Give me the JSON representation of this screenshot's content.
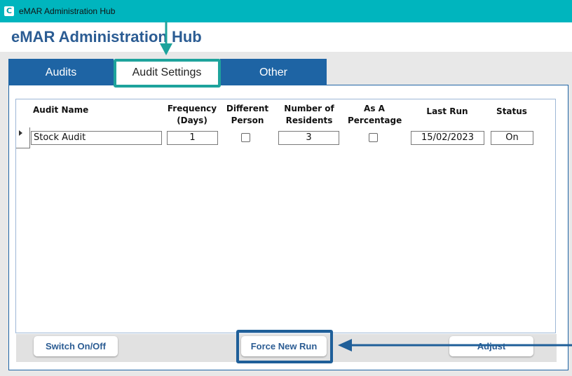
{
  "window": {
    "title": "eMAR Administration Hub",
    "icon_char": "C"
  },
  "header": {
    "title": "eMAR Administration Hub"
  },
  "tabs": [
    {
      "label": "Audits",
      "active": false
    },
    {
      "label": "Audit Settings",
      "active": true
    },
    {
      "label": "Other",
      "active": false
    }
  ],
  "table": {
    "columns": {
      "audit_name": "Audit Name",
      "frequency": [
        "Frequency",
        "(Days)"
      ],
      "different_person": [
        "Different",
        "Person"
      ],
      "number_of_residents": [
        "Number of",
        "Residents"
      ],
      "as_a_percentage": [
        "As A",
        "Percentage"
      ],
      "last_run": "Last Run",
      "status": "Status"
    },
    "rows": [
      {
        "audit_name": "Stock Audit",
        "frequency": "1",
        "different_person": false,
        "number_of_residents": "3",
        "as_a_percentage": false,
        "last_run": "15/02/2023",
        "status": "On"
      }
    ]
  },
  "buttons": {
    "switch_on_off": "Switch On/Off",
    "force_new_run": "Force New Run",
    "adjust": "Adjust"
  },
  "colors": {
    "titlebar": "#00b5be",
    "tab_blue": "#1e64a4",
    "title_text": "#2b5c93",
    "teal_annotation": "#1ea39c",
    "blue_annotation": "#1f5f99"
  }
}
